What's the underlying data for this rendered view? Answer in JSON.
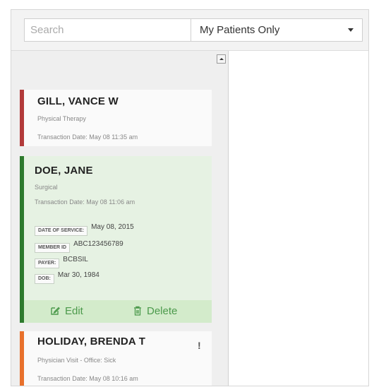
{
  "filter": {
    "search_placeholder": "Search",
    "scope_selected": "My Patients Only"
  },
  "colors": {
    "physical_therapy_stripe": "#b23a3a",
    "surgical_stripe": "#2d7a2d",
    "physician_visit_stripe": "#e8712c",
    "selected_card_bg": "#e6f2e3",
    "action_bar_bg": "#d3ebcb",
    "action_text": "#4c9a4c"
  },
  "patients": [
    {
      "name": "GILL, VANCE W",
      "type": "Physical Therapy",
      "transaction": "Transaction Date: May 08 11:35 am"
    },
    {
      "name": "DOE,  JANE",
      "type": "Surgical",
      "transaction": "Transaction Date: May 08 11:06 am",
      "details": [
        {
          "label": "DATE OF SERVICE:",
          "value": "May 08, 2015"
        },
        {
          "label": "MEMBER ID",
          "value": "ABC123456789"
        },
        {
          "label": "PAYER:",
          "value": "BCBSIL"
        },
        {
          "label": "DOB:",
          "value": "Mar 30, 1984"
        }
      ],
      "actions": {
        "edit": "Edit",
        "delete": "Delete",
        "edit_icon": "edit-icon",
        "delete_icon": "trash-icon"
      }
    },
    {
      "name": "HOLIDAY, BRENDA T",
      "type": "Physician Visit - Office: Sick",
      "transaction": "Transaction Date: May 08 10:16 am",
      "alert": "!"
    }
  ]
}
